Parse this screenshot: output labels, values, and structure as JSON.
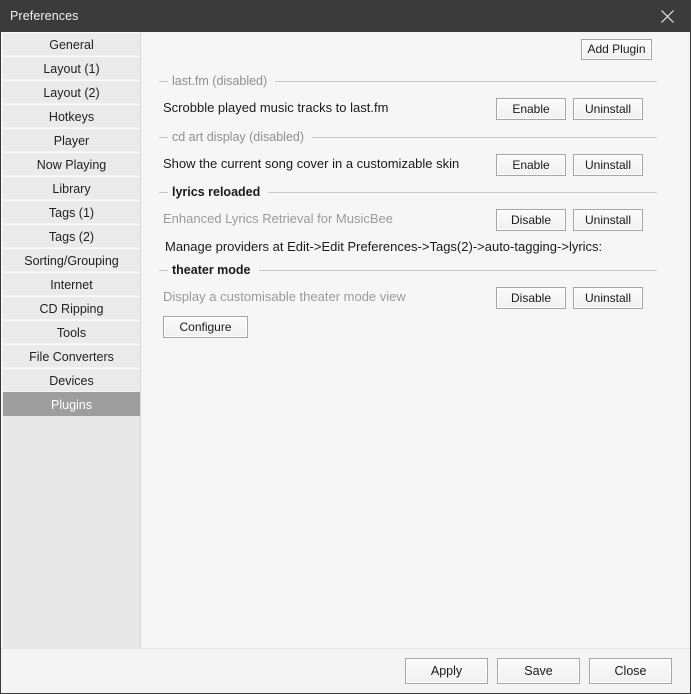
{
  "window": {
    "title": "Preferences",
    "close_icon": "close-icon"
  },
  "sidebar": {
    "items": [
      {
        "label": "General",
        "selected": false
      },
      {
        "label": "Layout (1)",
        "selected": false
      },
      {
        "label": "Layout (2)",
        "selected": false
      },
      {
        "label": "Hotkeys",
        "selected": false
      },
      {
        "label": "Player",
        "selected": false
      },
      {
        "label": "Now Playing",
        "selected": false
      },
      {
        "label": "Library",
        "selected": false
      },
      {
        "label": "Tags (1)",
        "selected": false
      },
      {
        "label": "Tags (2)",
        "selected": false
      },
      {
        "label": "Sorting/Grouping",
        "selected": false
      },
      {
        "label": "Internet",
        "selected": false
      },
      {
        "label": "CD Ripping",
        "selected": false
      },
      {
        "label": "Tools",
        "selected": false
      },
      {
        "label": "File Converters",
        "selected": false
      },
      {
        "label": "Devices",
        "selected": false
      },
      {
        "label": "Plugins",
        "selected": true
      }
    ]
  },
  "toolbar": {
    "add_plugin_label": "Add Plugin"
  },
  "plugins": [
    {
      "title": "last.fm (disabled)",
      "title_strong": false,
      "description": "Scrobble played music tracks to last.fm",
      "description_muted": false,
      "toggle_label": "Enable",
      "uninstall_label": "Uninstall",
      "note": null,
      "configure_label": null
    },
    {
      "title": "cd art display (disabled)",
      "title_strong": false,
      "description": "Show the current song cover in a customizable skin",
      "description_muted": false,
      "toggle_label": "Enable",
      "uninstall_label": "Uninstall",
      "note": null,
      "configure_label": null
    },
    {
      "title": "lyrics reloaded",
      "title_strong": true,
      "description": "Enhanced Lyrics Retrieval for MusicBee",
      "description_muted": true,
      "toggle_label": "Disable",
      "uninstall_label": "Uninstall",
      "note": "Manage providers at Edit->Edit Preferences->Tags(2)->auto-tagging->lyrics:",
      "configure_label": null
    },
    {
      "title": "theater mode",
      "title_strong": true,
      "description": "Display a customisable theater mode view",
      "description_muted": true,
      "toggle_label": "Disable",
      "uninstall_label": "Uninstall",
      "note": null,
      "configure_label": "Configure"
    }
  ],
  "footer": {
    "apply_label": "Apply",
    "save_label": "Save",
    "close_label": "Close"
  },
  "colors": {
    "titlebar_bg": "#3b3b3b",
    "selected_item_bg": "#9e9e9e",
    "panel_bg": "#f6f6f6",
    "sidebar_bg": "#eaeaea",
    "muted_text": "#9a9a9a"
  }
}
